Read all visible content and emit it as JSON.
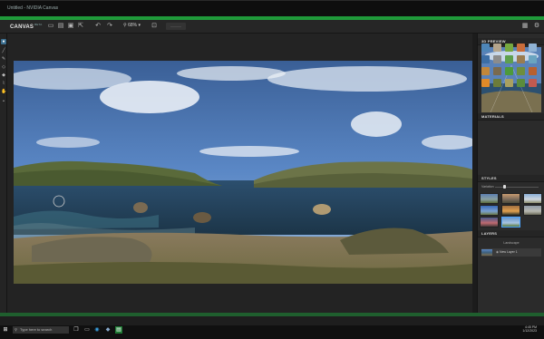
{
  "app": {
    "window_title": "Untitled - NVIDIA Canvas",
    "logo_text": "CANVAS",
    "logo_badge": "BETA",
    "zoom": "68%",
    "disabled_button_label": "———"
  },
  "toolbar_icons": [
    "new-file-icon",
    "open-folder-icon",
    "save-icon",
    "export-icon",
    "undo-icon",
    "redo-icon",
    "zoom-icon",
    "fit-icon"
  ],
  "right_panel": {
    "preview_title": "3D PREVIEW",
    "materials_title": "MATERIALS",
    "styles_title": "STYLES",
    "variation_label": "Variation",
    "variation_value": 0.2,
    "layers_title": "LAYERS",
    "layers": [
      {
        "name": "Landscape"
      },
      {
        "name": "New Layer 1"
      }
    ]
  },
  "materials_colors": [
    "#4e86b8",
    "#b5a58c",
    "#76a840",
    "#c96c3a",
    "#8fb2d4",
    "#3c6ea5",
    "#8c8c8c",
    "#5ea04e",
    "#9a7c50",
    "#6aa4c0",
    "#c2873a",
    "#7a6a4e",
    "#4d9a3b",
    "#6e8e3c",
    "#b86030",
    "#e08a28",
    "#6c7c3a",
    "#a8a060",
    "#5a8c3c",
    "#c05a50"
  ],
  "taskbar": {
    "search_placeholder": "Type here to search",
    "time": "4:45 PM",
    "date": "1/12/2023"
  },
  "colors": {
    "accent_green": "#1f9a3a",
    "selection_blue": "#4aa3ff"
  }
}
